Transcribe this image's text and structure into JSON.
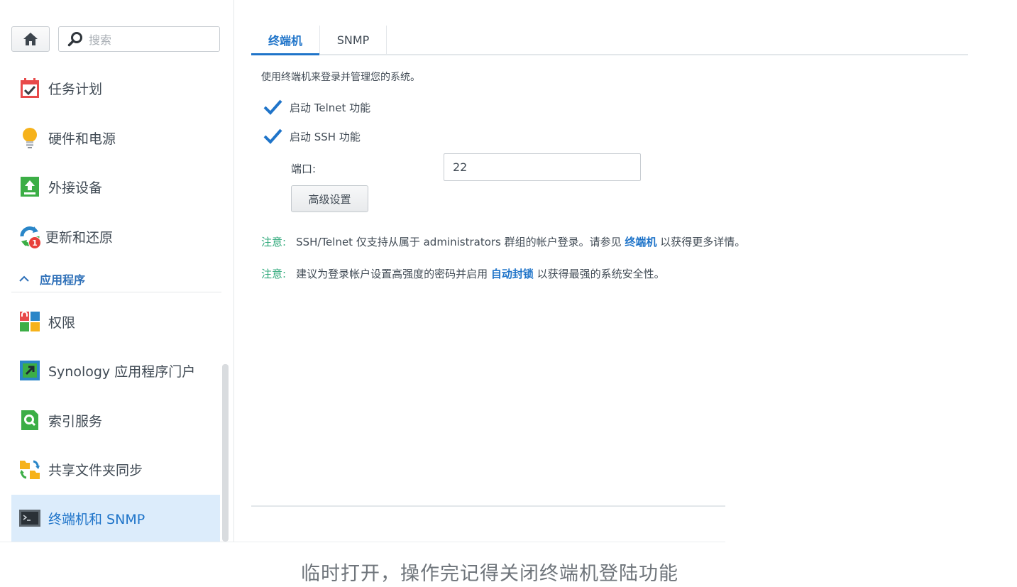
{
  "sidebar": {
    "search_placeholder": "搜索",
    "items": [
      {
        "label": "任务计划"
      },
      {
        "label": "硬件和电源"
      },
      {
        "label": "外接设备"
      },
      {
        "label": "更新和还原",
        "badge": "1"
      },
      {
        "label": "权限"
      },
      {
        "label": "Synology 应用程序门户"
      },
      {
        "label": "索引服务"
      },
      {
        "label": "共享文件夹同步"
      },
      {
        "label": "终端机和 SNMP"
      }
    ],
    "section_header": "应用程序"
  },
  "tabs": [
    {
      "label": "终端机"
    },
    {
      "label": "SNMP"
    }
  ],
  "terminal": {
    "description": "使用终端机来登录并管理您的系统。",
    "telnet_label": "启动 Telnet 功能",
    "telnet_checked": true,
    "ssh_label": "启动 SSH 功能",
    "ssh_checked": true,
    "port_label": "端口:",
    "port_value": "22",
    "advanced_button": "高级设置",
    "note1": {
      "label": "注意:",
      "text_before": "SSH/Telnet 仅支持从属于 administrators 群组的帐户登录。请参见",
      "link": "终端机",
      "text_after": "以获得更多详情。"
    },
    "note2": {
      "label": "注意:",
      "text_before": "建议为登录帐户设置高强度的密码并启用",
      "link": "自动封锁",
      "text_after": "以获得最强的系统安全性。"
    }
  },
  "caption": "临时打开，操作完记得关闭终端机登陆功能",
  "colors": {
    "accent": "#1f74c9",
    "note_label": "#2ea87a",
    "active_bg": "#dcecfb"
  }
}
